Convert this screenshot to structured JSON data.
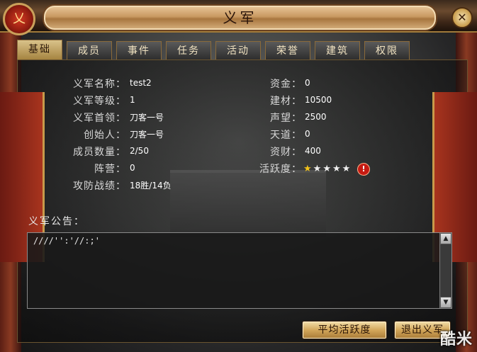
{
  "window": {
    "title": "义军",
    "emblem_glyph": "乂",
    "close_glyph": "✕"
  },
  "tabs": [
    {
      "label": "基础",
      "active": true
    },
    {
      "label": "成员"
    },
    {
      "label": "事件"
    },
    {
      "label": "任务"
    },
    {
      "label": "活动"
    },
    {
      "label": "荣誉"
    },
    {
      "label": "建筑"
    },
    {
      "label": "权限"
    }
  ],
  "info_left": [
    {
      "label": "义军名称：",
      "value": "test2"
    },
    {
      "label": "义军等级：",
      "value": "1"
    },
    {
      "label": "义军首领：",
      "value": "刀客一号"
    },
    {
      "label": "创始人：",
      "value": "刀客一号"
    },
    {
      "label": "成员数量：",
      "value": "2/50"
    },
    {
      "label": "阵营：",
      "value": "0"
    },
    {
      "label": "攻防战绩：",
      "value": "18胜/14负"
    }
  ],
  "info_right": [
    {
      "label": "资金：",
      "value": "0"
    },
    {
      "label": "建材：",
      "value": "10500"
    },
    {
      "label": "声望：",
      "value": "2500"
    },
    {
      "label": "天道：",
      "value": "0"
    },
    {
      "label": "资财：",
      "value": "400"
    }
  ],
  "activity": {
    "label": "活跃度：",
    "rating": 1,
    "max": 5,
    "star_glyph": "★",
    "warn_glyph": "!"
  },
  "notice": {
    "label": "义军公告：",
    "text": "////'':'//:;'"
  },
  "scroll": {
    "up": "▲",
    "down": "▼"
  },
  "buttons": {
    "average_activity": "平均活跃度",
    "quit": "退出义军"
  },
  "watermark": "酷米",
  "colors": {
    "gold": "#d3a75a",
    "star_on": "#f2c21a",
    "warn": "#c61a12"
  }
}
